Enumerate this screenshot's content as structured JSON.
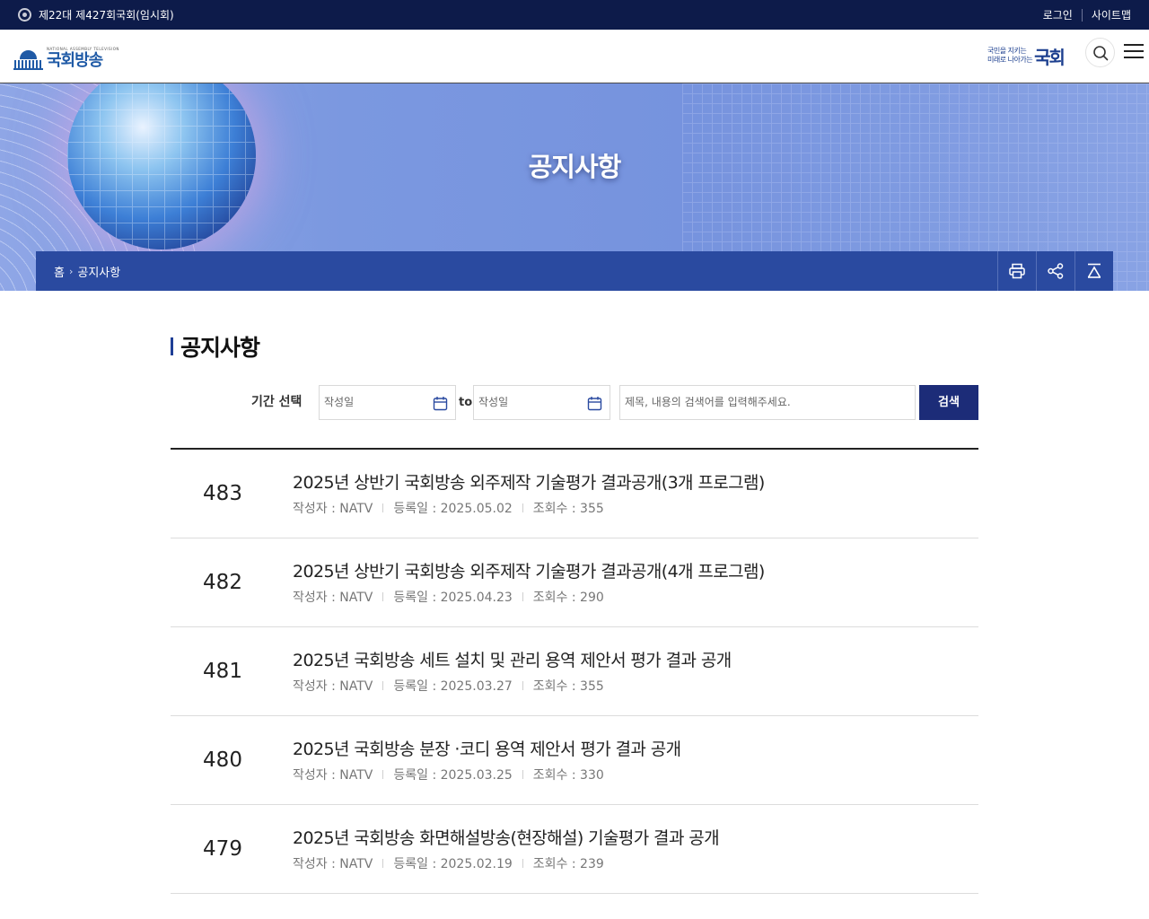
{
  "topbar": {
    "session": "제22대 제427회국회(임시회)",
    "login": "로그인",
    "sitemap": "사이트맵"
  },
  "header": {
    "logo_sub": "NATIONAL ASSEMBLY TELEVISION",
    "logo_text": "국회방송",
    "slogan_line1": "국민을 지키는",
    "slogan_line2": "미래로 나아가는",
    "slogan_big": "국회",
    "search_icon": "search-icon",
    "menu_icon": "hamburger-menu-icon"
  },
  "banner": {
    "title": "공지사항",
    "breadcrumb": [
      "홈",
      "공지사항"
    ],
    "utilities": [
      "print-icon",
      "share-icon",
      "scroll-top-icon"
    ]
  },
  "content": {
    "heading": "공지사항",
    "filter": {
      "label": "기간 선택",
      "start_placeholder": "작성일",
      "to": "to",
      "end_placeholder": "작성일",
      "keyword_placeholder": "제목, 내용의 검색어를 입력해주세요.",
      "submit": "검색"
    },
    "posts": [
      {
        "num": "483",
        "title": "2025년 상반기 국회방송 외주제작 기술평가 결과공개(3개 프로그램)",
        "author": "작성자 : NATV",
        "date": "등록일 : 2025.05.02",
        "views": "조회수 : 355"
      },
      {
        "num": "482",
        "title": "2025년 상반기 국회방송 외주제작 기술평가 결과공개(4개 프로그램)",
        "author": "작성자 : NATV",
        "date": "등록일 : 2025.04.23",
        "views": "조회수 : 290"
      },
      {
        "num": "481",
        "title": "2025년 국회방송 세트 설치 및 관리 용역 제안서 평가 결과 공개",
        "author": "작성자 : NATV",
        "date": "등록일 : 2025.03.27",
        "views": "조회수 : 355"
      },
      {
        "num": "480",
        "title": "2025년 국회방송 분장 ·코디 용역 제안서 평가 결과 공개",
        "author": "작성자 : NATV",
        "date": "등록일 : 2025.03.25",
        "views": "조회수 : 330"
      },
      {
        "num": "479",
        "title": "2025년 국회방송 화면해설방송(현장해설) 기술평가 결과 공개",
        "author": "작성자 : NATV",
        "date": "등록일 : 2025.02.19",
        "views": "조회수 : 239"
      }
    ]
  },
  "colors": {
    "topbar": "#0d1b4a",
    "accent": "#2a4aa0",
    "button": "#1c2c78"
  }
}
